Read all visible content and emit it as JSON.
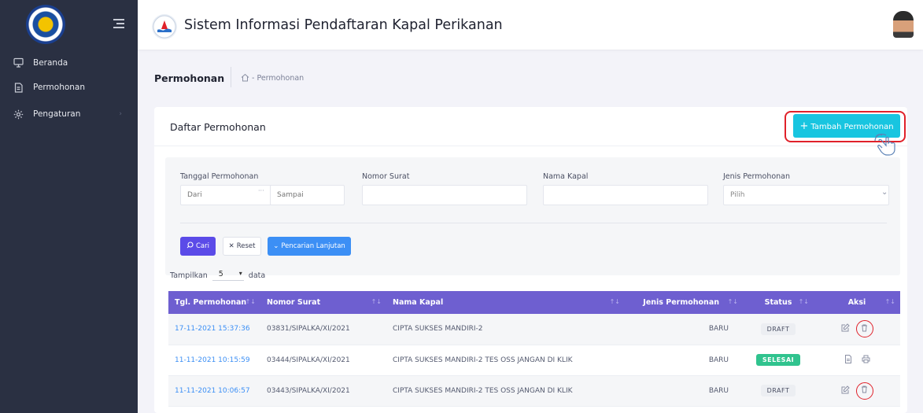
{
  "app": {
    "title": "Sistem Informasi Pendaftaran Kapal Perikanan"
  },
  "sidebar": {
    "items": [
      {
        "label": "Beranda",
        "icon": "monitor-icon"
      },
      {
        "label": "Permohonan",
        "icon": "document-icon"
      },
      {
        "label": "Pengaturan",
        "icon": "gear-icon"
      }
    ]
  },
  "breadcrumb": {
    "title": "Permohonan",
    "link": "- Permohonan"
  },
  "card": {
    "title": "Daftar Permohonan",
    "add_button": "Tambah Permohonan"
  },
  "filters": {
    "tanggal_label": "Tanggal Permohonan",
    "dari_placeholder": "Dari",
    "sampai_placeholder": "Sampai",
    "nomor_label": "Nomor Surat",
    "nama_label": "Nama Kapal",
    "jenis_label": "Jenis Permohonan",
    "jenis_selected": "Pilih",
    "cari_button": "Cari",
    "reset_button": "Reset",
    "lanjut_button": "Pencarian Lanjutan"
  },
  "length": {
    "prefix": "Tampilkan",
    "value": "5",
    "suffix": "data"
  },
  "table": {
    "columns": [
      "Tgl. Permohonan",
      "Nomor Surat",
      "Nama Kapal",
      "Jenis Permohonan",
      "Status",
      "Aksi"
    ],
    "rows": [
      {
        "date": "17-11-2021 15:37:36",
        "nomor": "03831/SIPALKA/XI/2021",
        "nama": "CIPTA SUKSES MANDIRI-2",
        "jenis": "BARU",
        "status": "DRAFT"
      },
      {
        "date": "11-11-2021 10:15:59",
        "nomor": "03444/SIPALKA/XI/2021",
        "nama": "CIPTA SUKSES MANDIRI-2 TES OSS JANGAN DI KLIK",
        "jenis": "BARU",
        "status": "SELESAI"
      },
      {
        "date": "11-11-2021 10:06:57",
        "nomor": "03443/SIPALKA/XI/2021",
        "nama": "CIPTA SUKSES MANDIRI-2 TES OSS JANGAN DI KLIK",
        "jenis": "BARU",
        "status": "DRAFT"
      }
    ]
  },
  "colors": {
    "sidebar": "#2a3042",
    "accent": "#6e5fd0",
    "cyan": "#18c5e0",
    "highlight": "#e0212a",
    "success": "#30c38e"
  }
}
